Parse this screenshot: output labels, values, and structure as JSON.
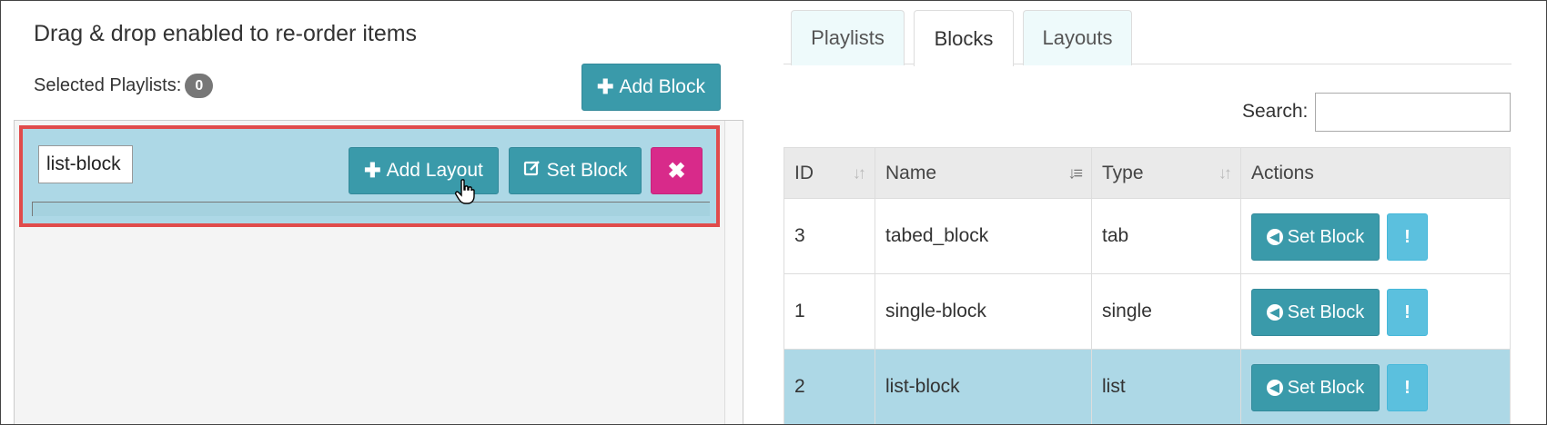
{
  "left": {
    "title": "Drag & drop enabled to re-order items",
    "selected_label": "Selected Playlists:",
    "selected_count": "0",
    "add_block_label": "Add Block",
    "block": {
      "name_value": "list-block",
      "add_layout_label": "Add Layout",
      "set_block_label": "Set Block",
      "delete_glyph": "✖"
    }
  },
  "right": {
    "tabs": [
      {
        "label": "Playlists"
      },
      {
        "label": "Blocks"
      },
      {
        "label": "Layouts"
      }
    ],
    "active_tab": "Blocks",
    "search_label": "Search:",
    "search_value": "",
    "table": {
      "headers": [
        "ID",
        "Name",
        "Type",
        "Actions"
      ],
      "rows": [
        {
          "id": "3",
          "name": "tabed_block",
          "type": "tab",
          "action_label": "Set Block",
          "info_glyph": "!"
        },
        {
          "id": "1",
          "name": "single-block",
          "type": "single",
          "action_label": "Set Block",
          "info_glyph": "!"
        },
        {
          "id": "2",
          "name": "list-block",
          "type": "list",
          "action_label": "Set Block",
          "info_glyph": "!"
        }
      ]
    }
  },
  "colors": {
    "primary": "#3a9aaa",
    "danger": "#d82a8a",
    "info": "#5bc0de",
    "selected_row": "#add8e6",
    "highlight_border": "#e04b4b"
  }
}
